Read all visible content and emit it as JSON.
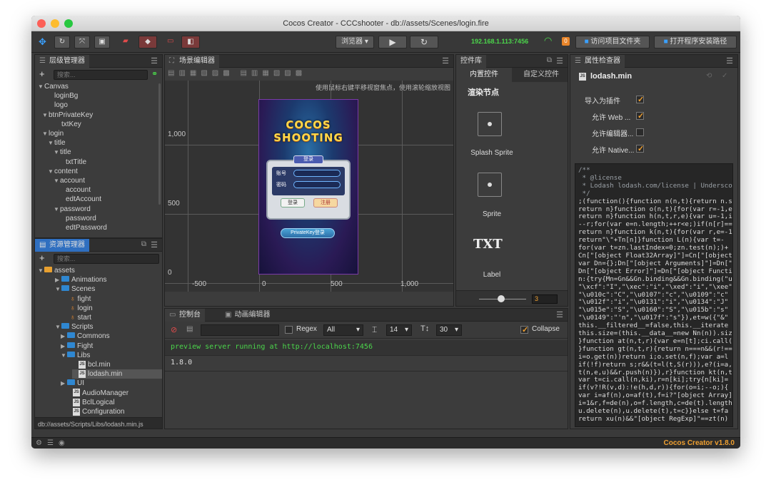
{
  "window": {
    "title": "Cocos Creator - CCCshooter - db://assets/Scenes/login.fire"
  },
  "toolbar": {
    "browser_label": "浏览器",
    "ip_text": "192.168.1.113:7456",
    "badge_count": "0",
    "open_project_label": "访问项目文件夹",
    "open_install_label": "打开程序安装路径"
  },
  "hierarchy": {
    "title": "层级管理器",
    "search_placeholder": "搜索...",
    "nodes": [
      {
        "label": "Canvas",
        "arrow": "▼"
      },
      {
        "label": "loginBg",
        "arrow": ""
      },
      {
        "label": "logo",
        "arrow": ""
      },
      {
        "label": "btnPrivateKey",
        "arrow": "▼"
      },
      {
        "label": "txtKey",
        "arrow": ""
      },
      {
        "label": "login",
        "arrow": "▼"
      },
      {
        "label": "title",
        "arrow": "▼"
      },
      {
        "label": "title",
        "arrow": "▼"
      },
      {
        "label": "txtTitle",
        "arrow": ""
      },
      {
        "label": "content",
        "arrow": "▼"
      },
      {
        "label": "account",
        "arrow": "▼"
      },
      {
        "label": "account",
        "arrow": ""
      },
      {
        "label": "edtAccount",
        "arrow": ""
      },
      {
        "label": "password",
        "arrow": "▼"
      },
      {
        "label": "password",
        "arrow": ""
      },
      {
        "label": "edtPassword",
        "arrow": ""
      }
    ]
  },
  "assets": {
    "title": "资源管理器",
    "search_placeholder": "搜索...",
    "items": [
      {
        "label": "assets",
        "arrow": "▼",
        "kind": "root"
      },
      {
        "label": "Animations",
        "arrow": "▶",
        "kind": "folder"
      },
      {
        "label": "Scenes",
        "arrow": "▼",
        "kind": "folder"
      },
      {
        "label": "fight",
        "arrow": "",
        "kind": "fire"
      },
      {
        "label": "login",
        "arrow": "",
        "kind": "fire"
      },
      {
        "label": "start",
        "arrow": "",
        "kind": "fire"
      },
      {
        "label": "Scripts",
        "arrow": "▼",
        "kind": "folder"
      },
      {
        "label": "Commons",
        "arrow": "▶",
        "kind": "folder"
      },
      {
        "label": "Fight",
        "arrow": "▶",
        "kind": "folder"
      },
      {
        "label": "Libs",
        "arrow": "▼",
        "kind": "folder"
      },
      {
        "label": "bcl.min",
        "arrow": "",
        "kind": "js"
      },
      {
        "label": "lodash.min",
        "arrow": "",
        "kind": "js"
      },
      {
        "label": "UI",
        "arrow": "▶",
        "kind": "folder"
      },
      {
        "label": "AudioManager",
        "arrow": "",
        "kind": "js"
      },
      {
        "label": "BclLogical",
        "arrow": "",
        "kind": "js"
      },
      {
        "label": "Configuration",
        "arrow": "",
        "kind": "js"
      }
    ],
    "path": "db://assets/Scripts/Libs/lodash.min.js"
  },
  "scene": {
    "title": "场景编辑器",
    "hint": "使用鼠标右键平移视窗焦点，使用滚轮缩放视图",
    "y_labels": [
      "1,000",
      "500",
      "0"
    ],
    "x_labels": [
      "-500",
      "0",
      "500",
      "1,000"
    ],
    "game_title_1": "COCOS",
    "game_title_2": "SHOOTING",
    "login_title": "登录",
    "account_label": "账号",
    "password_label": "密码",
    "login_btn": "登录",
    "register_btn": "注册",
    "privatekey_btn": "PrivateKey登录"
  },
  "widgets": {
    "title": "控件库",
    "tab_builtin": "内置控件",
    "tab_custom": "自定义控件",
    "section": "渲染节点",
    "items": [
      "Splash Sprite",
      "Sprite",
      "Label"
    ],
    "txt_icon": "TXT",
    "zoom_value": "3"
  },
  "console": {
    "tab_console": "控制台",
    "tab_anim": "动画编辑器",
    "regex_label": "Regex",
    "level_value": "All",
    "font_size": "14",
    "line_height": "30",
    "collapse_label": "Collapse",
    "lines": [
      "preview server running at http://localhost:7456",
      "1.8.0"
    ]
  },
  "inspector": {
    "title": "属性检查器",
    "file_name": "lodash.min",
    "props": [
      {
        "label": "导入为插件",
        "checked": true
      },
      {
        "label": "允许 Web ...",
        "checked": true
      },
      {
        "label": "允许编辑器...",
        "checked": false
      },
      {
        "label": "允许 Native...",
        "checked": true
      }
    ],
    "code": [
      "/**",
      " * @license",
      " * Lodash lodash.com/license | Underscore",
      " */",
      ";(function(){function n(n,t){return n.s",
      "return n}function o(n,t){for(var r=-1,e",
      "return n}function h(n,t,r,e){var u=-1,i",
      "--r;for(var e=n.length;++r<e;)if(n[r]==",
      "return n}function k(n,t){for(var r,e=-1",
      "return\"\\\"+Tn[n]}function L(n){var t=-",
      "for(var t=zn.lastIndex=0;zn.test(n);)+",
      "Cn[\"[object Float32Array]\"]=Cn[\"[object",
      "var Dn={};Dn[\"[object Arguments]\"]=Dn[\"",
      "Dn[\"[object Error]\"]=Dn[\"[object Functi",
      "n:{try{Mn=Gn&&Gn.binding&&Gn.binding(\"ut",
      "\"\\xcf\":\"I\",\"\\xec\":\"i\",\"\\xed\":\"i\",\"\\xee\"",
      "\"\\u010c\":\"C\",\"\\u0107\":\"c\",\"\\u0109\":\"c\"",
      "\"\\u012f\":\"i\",\"\\u0131\":\"i\",\"\\u0134\":\"J\"",
      "\"\\u015e\":\"S\",\"\\u0160\":\"S\",\"\\u015b\":\"s\"",
      "\"\\u0149\":\"'n\",\"\\u017f\":\"s\"}),et=w({\"&\"",
      "this.__filtered__=false,this.__iterate",
      "this.size=(this.__data__=new Nn(n)).siz",
      "}function at(n,t,r){var e=n[t];ci.call(",
      "}function gt(n,t,r){return n===n&&(r!==",
      "i=o.get(n))return i;o.set(n,f);var a=l",
      "if(!f)return s;r&&(t=l(t,S(r))),e?(i=a,",
      "t(n,e,u)&&r.push(n)}),r}function kt(n,t",
      "var t=ci.call(n,ki),r=n[ki];try{n[ki]=",
      "if(v?!R(v,d):!e(h,d,r)){for(o=i;--o;){",
      "var i=af(n),o=af(t),f=i?\"[object Array]",
      "i=1&r,f=de(n),o=f.length,c=de(t).length",
      "u.delete(n),u.delete(t),t=c}}else t=fa",
      "return xu(n)&&\"[object RegExp]\"==zt(n)"
    ]
  },
  "status": {
    "version": "Cocos Creator v1.8.0"
  }
}
